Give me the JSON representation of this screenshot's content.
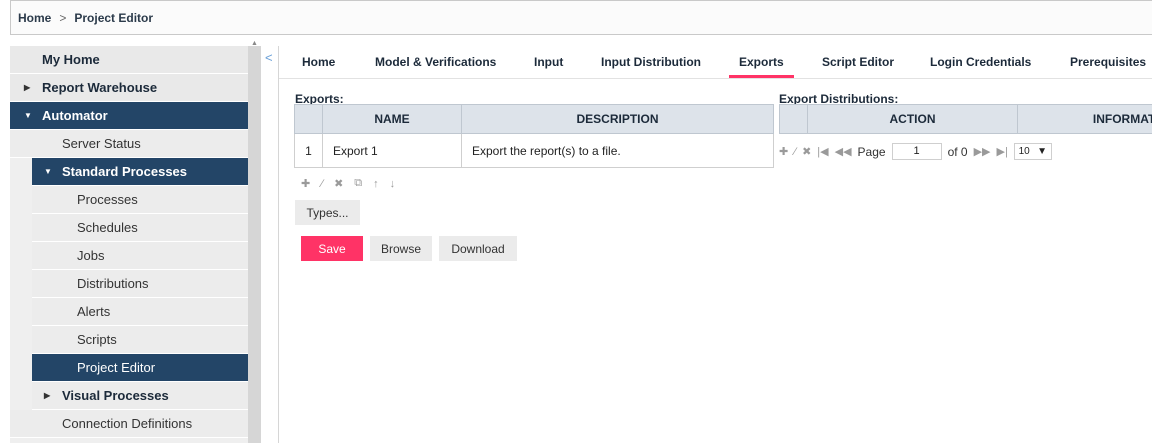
{
  "breadcrumb": {
    "home": "Home",
    "separator": ">",
    "current": "Project Editor"
  },
  "sidebar": {
    "my_home": "My Home",
    "report_warehouse": "Report Warehouse",
    "automator": "Automator",
    "server_status": "Server Status",
    "standard_processes": "Standard Processes",
    "sub_items": [
      "Processes",
      "Schedules",
      "Jobs",
      "Distributions",
      "Alerts",
      "Scripts"
    ],
    "project_editor": "Project Editor",
    "visual_processes": "Visual Processes",
    "connection_definitions": "Connection Definitions"
  },
  "collapse_glyph": "<",
  "tabs": [
    "Home",
    "Model & Verifications",
    "Input",
    "Input Distribution",
    "Exports",
    "Script Editor",
    "Login Credentials",
    "Prerequisites"
  ],
  "exports": {
    "label": "Exports:",
    "columns": [
      "NAME",
      "DESCRIPTION"
    ],
    "rows": [
      {
        "num": "1",
        "name": "Export 1",
        "description": "Export the report(s) to a file."
      }
    ],
    "types_button": "Types..."
  },
  "distributions": {
    "label": "Export Distributions:",
    "columns": [
      "ACTION",
      "INFORMATIO"
    ],
    "pager": {
      "page_label": "Page",
      "page_value": "1",
      "of_label": "of 0",
      "page_size": "10"
    }
  },
  "buttons": {
    "save": "Save",
    "browse": "Browse",
    "download": "Download"
  },
  "colors": {
    "accent": "#ff3366",
    "nav_dark": "#234567"
  }
}
